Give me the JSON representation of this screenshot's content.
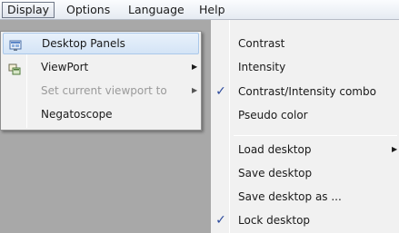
{
  "menubar": {
    "items": [
      {
        "label": "Display"
      },
      {
        "label": "Options"
      },
      {
        "label": "Language"
      },
      {
        "label": "Help"
      }
    ]
  },
  "display_menu": {
    "items": [
      {
        "label": "Desktop Panels",
        "icon": "desktop-panels-icon",
        "highlighted": true
      },
      {
        "label": "ViewPort",
        "icon": "viewport-icon",
        "submenu": true
      },
      {
        "label": "Set current viewport to",
        "disabled": true,
        "submenu": true
      },
      {
        "label": "Negatoscope"
      }
    ]
  },
  "submenu": {
    "items": [
      {
        "label": "Contrast",
        "checked": false
      },
      {
        "label": "Intensity",
        "checked": false
      },
      {
        "label": "Contrast/Intensity combo",
        "checked": true
      },
      {
        "label": "Pseudo color",
        "checked": false
      },
      {
        "label": "Load desktop",
        "submenu": true
      },
      {
        "label": "Save desktop"
      },
      {
        "label": "Save desktop as ..."
      },
      {
        "label": "Lock desktop",
        "checked": true
      }
    ]
  },
  "glyphs": {
    "arrow": "▶",
    "check": "✓"
  },
  "colors": {
    "highlight": "#d4e4f6",
    "highlight_border": "#aac8ea",
    "check": "#2c4a9c"
  }
}
